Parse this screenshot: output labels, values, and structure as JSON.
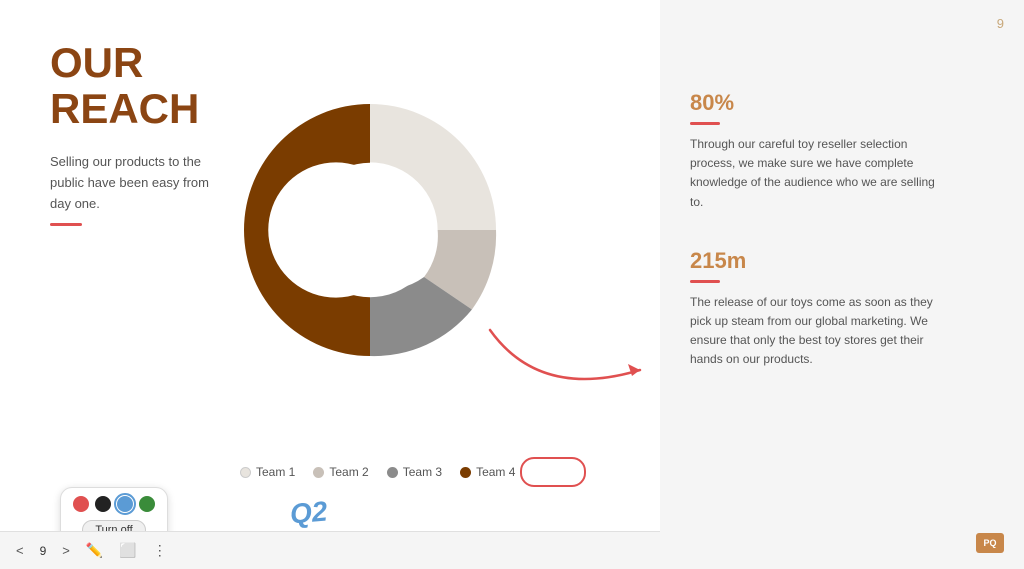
{
  "slide": {
    "page_number": "9",
    "title_line1": "OUR",
    "title_line2": "REACH",
    "subtitle": "Selling our products to the public have been easy from day one.",
    "chart": {
      "segments": [
        {
          "label": "Team 1",
          "color": "#e8e4de",
          "pct": 25
        },
        {
          "label": "Team 2",
          "color": "#c8c0b8",
          "pct": 10
        },
        {
          "label": "Team 3",
          "color": "#8B8B8B",
          "pct": 15
        },
        {
          "label": "Team 4",
          "color": "#7a3c00",
          "pct": 50
        }
      ]
    },
    "annotation_q2": "Q2",
    "stats": [
      {
        "value": "80%",
        "text": "Through our careful toy reseller selection process, we make sure we have complete knowledge of the audience who we are selling to."
      },
      {
        "value": "215m",
        "text": "The release of our toys come as soon as they pick up steam from our global marketing. We ensure that only the best toy stores get their hands on our products."
      }
    ],
    "toolbar": {
      "swatches": [
        "#e05050",
        "#222222",
        "#5b9bd5",
        "#3a8c3a"
      ],
      "turn_off_label": "Turn off"
    },
    "nav": {
      "prev": "<",
      "next": ">",
      "page": "9"
    }
  }
}
